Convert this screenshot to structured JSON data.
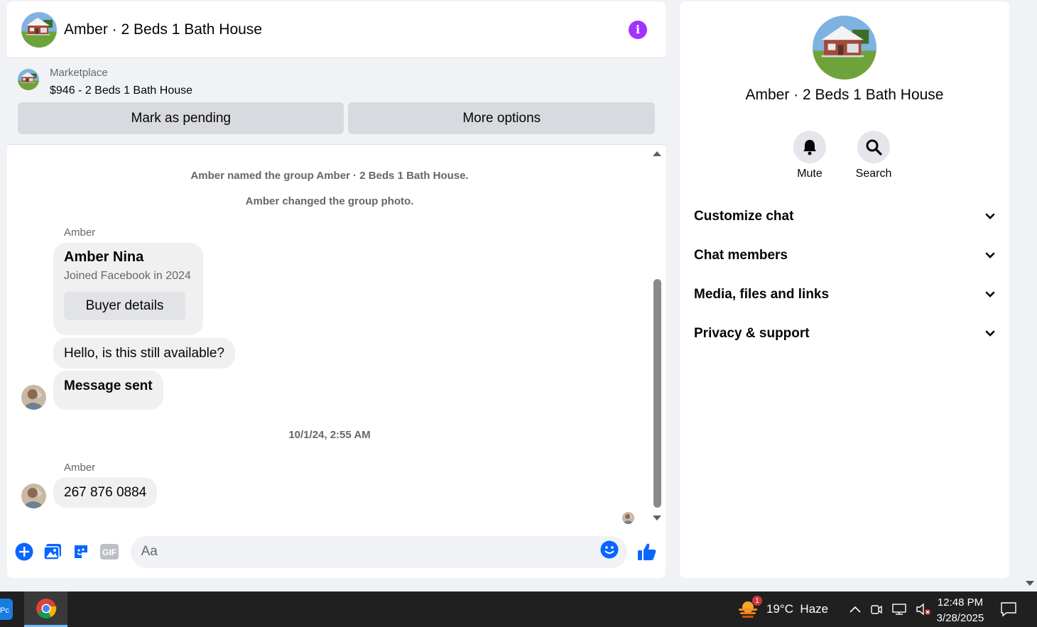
{
  "chat": {
    "title": "Amber · 2 Beds 1 Bath House",
    "marketplace": {
      "label": "Marketplace",
      "listing": "$946 - 2 Beds 1 Bath House",
      "pending_label": "Mark as pending",
      "more_label": "More options"
    },
    "system_messages": [
      "Amber named the group Amber · 2 Beds 1 Bath House.",
      "Amber changed the group photo."
    ],
    "card": {
      "sender": "Amber",
      "name": "Amber Nina",
      "sub": "Joined Facebook in 2024",
      "button": "Buyer details"
    },
    "messages": [
      "Hello, is this still available?",
      "Message sent"
    ],
    "timestamp": "10/1/24, 2:55 AM",
    "last": {
      "sender": "Amber",
      "text": "267 876 0884"
    },
    "composer": {
      "placeholder": "Aa"
    }
  },
  "side": {
    "title": "Amber · 2 Beds 1 Bath House",
    "actions": {
      "mute": "Mute",
      "search": "Search"
    },
    "menu": [
      "Customize chat",
      "Chat members",
      "Media, files and links",
      "Privacy & support"
    ]
  },
  "taskbar": {
    "weather": "19°C  Haze",
    "badge": "1",
    "time": "12:48 PM",
    "date": "3/28/2025"
  },
  "colors": {
    "accent_blue": "#0866ff",
    "info_purple": "#a033ff"
  }
}
